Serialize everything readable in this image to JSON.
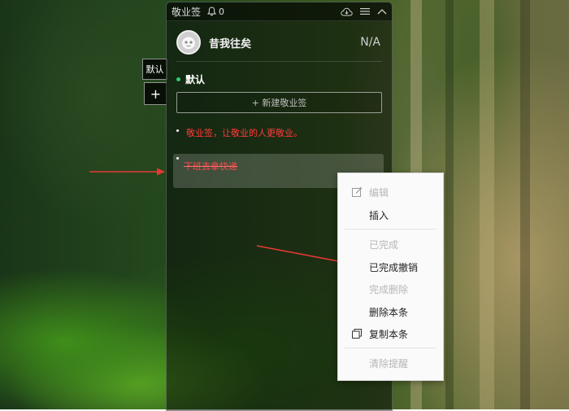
{
  "app": {
    "title": "敬业签",
    "reminder_count": "0"
  },
  "user": {
    "name": "昔我往矣",
    "status": "N/A"
  },
  "group": {
    "name": "默认"
  },
  "side_tab": {
    "label": "默认",
    "add_label": "+"
  },
  "new_note_button": "+ 新建敬业签",
  "notes": [
    {
      "text": "敬业签，让敬业的人更敬业。"
    },
    {
      "text": "下班去拿快递"
    }
  ],
  "context_menu": {
    "items": [
      {
        "label": "编辑",
        "icon": "edit-icon",
        "enabled": false
      },
      {
        "label": "插入",
        "enabled": true
      },
      {
        "label": "已完成",
        "enabled": false
      },
      {
        "label": "已完成撤销",
        "enabled": true
      },
      {
        "label": "完成删除",
        "enabled": false
      },
      {
        "label": "删除本条",
        "enabled": true
      },
      {
        "label": "复制本条",
        "icon": "copy-icon",
        "enabled": true
      },
      {
        "label": "清除提醒",
        "enabled": false
      }
    ]
  },
  "colors": {
    "accent_green": "#2ecc71",
    "note_red": "#ff3b3b",
    "arrow_red": "#e53935"
  }
}
